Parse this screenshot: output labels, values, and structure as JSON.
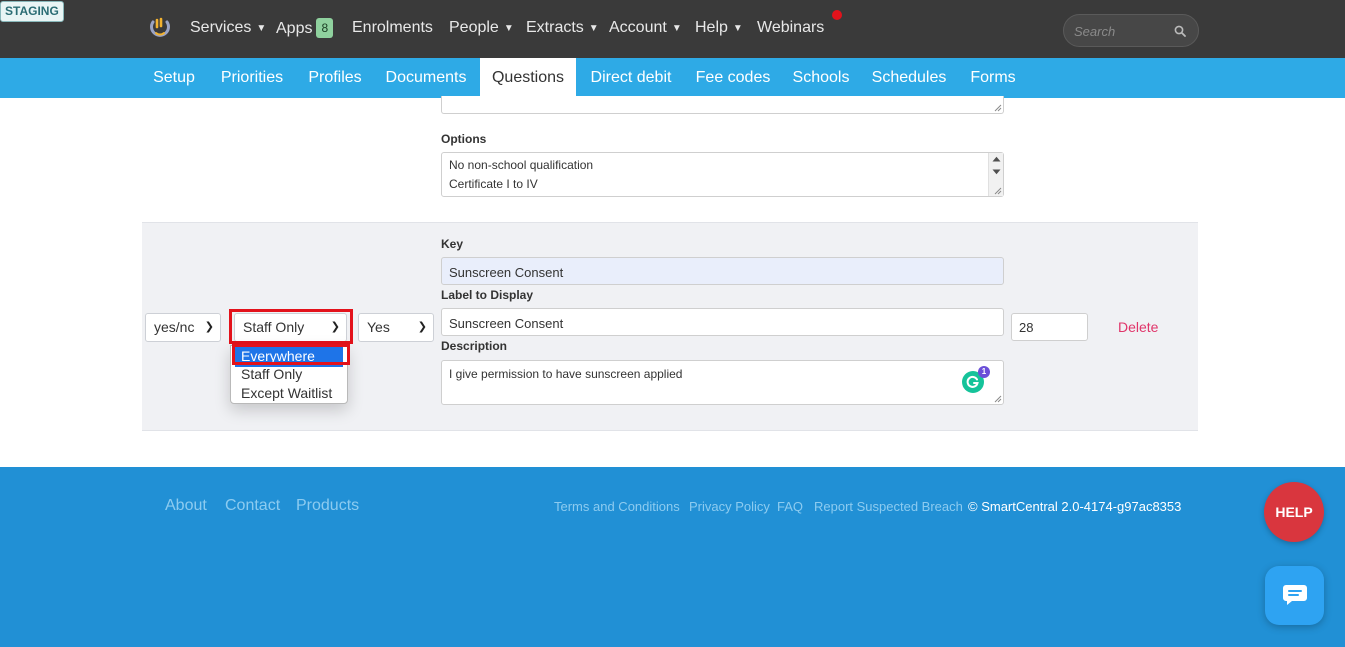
{
  "env_badge": "STAGING",
  "header": {
    "nav": [
      {
        "label": "Services",
        "dropdown": true
      },
      {
        "label": "Apps",
        "badge": "8",
        "dropdown": false
      },
      {
        "label": "Enrolments",
        "dropdown": false
      },
      {
        "label": "People",
        "dropdown": true
      },
      {
        "label": "Extracts",
        "dropdown": true
      },
      {
        "label": "Account",
        "dropdown": true
      },
      {
        "label": "Help",
        "dropdown": true
      },
      {
        "label": "Webinars",
        "dropdown": false
      }
    ],
    "search_placeholder": "Search"
  },
  "subnav": {
    "tabs": [
      "Setup",
      "Priorities",
      "Profiles",
      "Documents",
      "Questions",
      "Direct debit",
      "Fee codes",
      "Schools",
      "Schedules",
      "Forms"
    ],
    "active": "Questions"
  },
  "question1": {
    "options_label": "Options",
    "options_lines": [
      "No non-school qualification",
      "Certificate I to IV"
    ]
  },
  "question2": {
    "type_value": "yes/nc",
    "visibility_value": "Staff Only",
    "default_value": "Yes",
    "key_label": "Key",
    "key_value": "Sunscreen Consent",
    "label_label": "Label to Display",
    "label_value": "Sunscreen Consent",
    "description_label": "Description",
    "description_value": "I give permission to have sunscreen applied",
    "order_value": "28",
    "delete_label": "Delete",
    "grammarly_count": "1"
  },
  "visibility_dropdown": {
    "options": [
      "Everywhere",
      "Staff Only",
      "Except Waitlist"
    ],
    "highlighted": "Everywhere"
  },
  "footer": {
    "links_left": [
      "About",
      "Contact",
      "Products"
    ],
    "links_right": [
      "Terms and Conditions",
      "Privacy Policy",
      "FAQ",
      "Report Suspected Breach"
    ],
    "copyright": "©  SmartCentral 2.0-4174-g97ac8353"
  },
  "help_button_label": "HELP",
  "colors": {
    "header_bg": "#3a3a3a",
    "subnav_bg": "#2eaae6",
    "footer_bg": "#2190d5",
    "delete_text": "#e0356a",
    "highlight_box": "#e3121b",
    "help_button": "#d9363e"
  }
}
